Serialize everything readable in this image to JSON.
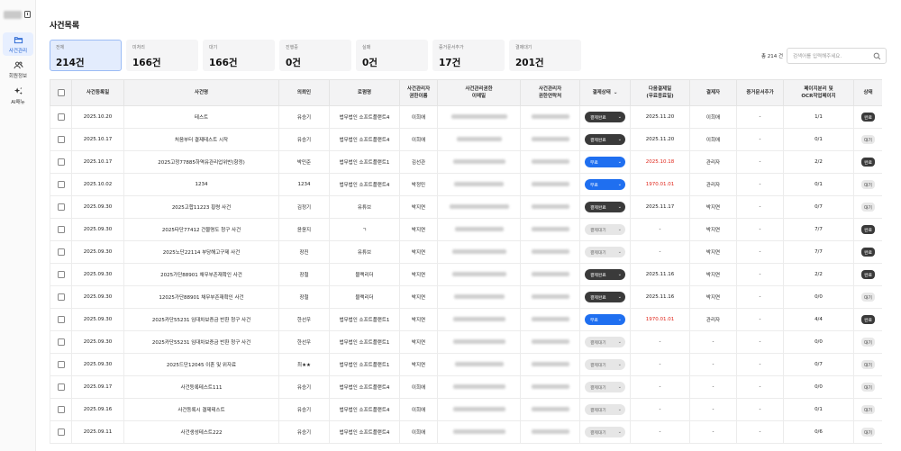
{
  "sidebar": {
    "items": [
      {
        "label": "사건관리",
        "icon": "folder-icon",
        "active": true
      },
      {
        "label": "회원정보",
        "icon": "users-icon",
        "active": false
      },
      {
        "label": "AI매뉴",
        "icon": "sparkle-icon",
        "active": false
      }
    ]
  },
  "page": {
    "title": "사건목록"
  },
  "summary": [
    {
      "label": "전체",
      "value": "214건",
      "active": true
    },
    {
      "label": "미처리",
      "value": "166건"
    },
    {
      "label": "대기",
      "value": "166건"
    },
    {
      "label": "진행중",
      "value": "0건"
    },
    {
      "label": "실패",
      "value": "0건"
    },
    {
      "label": "증거문서추가",
      "value": "17건"
    },
    {
      "label": "결제대기",
      "value": "201건"
    }
  ],
  "toolbar": {
    "total": "총 214 건",
    "search_placeholder": "검색어를 입력해주세요."
  },
  "table": {
    "headers": {
      "reg_date": "사건등록일",
      "case_name": "사건명",
      "client": "의뢰인",
      "law_firm": "로펌명",
      "manager_name_1": "사건관리자",
      "manager_name_2": "권한이름",
      "manager_email_1": "사건관리권한",
      "manager_email_2": "이메일",
      "manager_contact_1": "사건관리자",
      "manager_contact_2": "권한연락처",
      "pay_status": "결제상태",
      "next_pay_1": "다음결제일",
      "next_pay_2": "(무료종료일)",
      "payer": "결제자",
      "evidence": "증거문서추가",
      "pages_1": "페이지분리 및",
      "pages_2": "OCR작업페이지",
      "status": "상태"
    },
    "rows": [
      {
        "date": "2025.10.20",
        "name": "테스트",
        "client": "유승기",
        "firm": "법무법인 소프트플랜트4",
        "manager": "이희애",
        "pay": "결제완료",
        "pay_style": "dark",
        "next": "2025.11.20",
        "next_red": false,
        "payer": "이희애",
        "evidence": "-",
        "pages": "1/1",
        "status": "완료"
      },
      {
        "date": "2025.10.17",
        "name": "처음부터 결제테스트 시작",
        "client": "유승기",
        "firm": "법무법인 소프트플랜트4",
        "manager": "이희애",
        "pay": "결제완료",
        "pay_style": "dark",
        "next": "2025.11.20",
        "next_red": false,
        "payer": "이희애",
        "evidence": "-",
        "pages": "0/1",
        "status": "대기"
      },
      {
        "date": "2025.10.17",
        "name": "2025고정77885하역유관리업위반(항정)",
        "client": "박민준",
        "firm": "법무법인 소프트플랜트1",
        "manager": "김선관",
        "pay": "무료",
        "pay_style": "blue",
        "next": "2025.10.18",
        "next_red": true,
        "payer": "관리자",
        "evidence": "-",
        "pages": "2/2",
        "status": "완료"
      },
      {
        "date": "2025.10.02",
        "name": "1234",
        "client": "1234",
        "firm": "법무법인 소프트플랜트4",
        "manager": "박정민",
        "pay": "무료",
        "pay_style": "blue",
        "next": "1970.01.01",
        "next_red": true,
        "payer": "관리자",
        "evidence": "-",
        "pages": "0/1",
        "status": "대기"
      },
      {
        "date": "2025.09.30",
        "name": "2025고합11223 횡령 사건",
        "client": "김정기",
        "firm": "유튜브",
        "manager": "박지연",
        "pay": "결제완료",
        "pay_style": "dark",
        "next": "2025.11.17",
        "next_red": false,
        "payer": "박지연",
        "evidence": "-",
        "pages": "0/7",
        "status": "대기"
      },
      {
        "date": "2025.09.30",
        "name": "2025타단77412 건물명도 청구 사건",
        "client": "윤윤지",
        "firm": "ㄱ",
        "manager": "박지연",
        "pay": "결제대기",
        "pay_style": "gray",
        "next": "-",
        "next_red": false,
        "payer": "박지연",
        "evidence": "-",
        "pages": "7/7",
        "status": "완료"
      },
      {
        "date": "2025.09.30",
        "name": "2025노단22114 부당해고구제 사건",
        "client": "장진",
        "firm": "유튜브",
        "manager": "박지연",
        "pay": "결제대기",
        "pay_style": "gray",
        "next": "-",
        "next_red": false,
        "payer": "박지연",
        "evidence": "-",
        "pages": "7/7",
        "status": "완료"
      },
      {
        "date": "2025.09.30",
        "name": "2025가단88901 채무부존재확인 사건",
        "client": "장철",
        "firm": "블랙리더",
        "manager": "박지연",
        "pay": "결제완료",
        "pay_style": "dark",
        "next": "2025.11.16",
        "next_red": false,
        "payer": "박지연",
        "evidence": "-",
        "pages": "2/2",
        "status": "완료"
      },
      {
        "date": "2025.09.30",
        "name": "12025가단88901 채무부존재확인 사건",
        "client": "장철",
        "firm": "블랙리더",
        "manager": "박지연",
        "pay": "결제완료",
        "pay_style": "dark",
        "next": "2025.11.16",
        "next_red": false,
        "payer": "박지연",
        "evidence": "-",
        "pages": "0/0",
        "status": "대기"
      },
      {
        "date": "2025.09.30",
        "name": "2025카단55231 임대차보증금 반환 청구 사건",
        "client": "한선우",
        "firm": "법무법인 소프트플랜트1",
        "manager": "박지연",
        "pay": "무료",
        "pay_style": "blue",
        "next": "1970.01.01",
        "next_red": true,
        "payer": "관리자",
        "evidence": "-",
        "pages": "4/4",
        "status": "완료"
      },
      {
        "date": "2025.09.30",
        "name": "2025카단55231 임대차보증금 반환 청구 사건",
        "client": "한선우",
        "firm": "법무법인 소프트플랜트1",
        "manager": "박지연",
        "pay": "결제대기",
        "pay_style": "gray",
        "next": "-",
        "next_red": false,
        "payer": "-",
        "evidence": "-",
        "pages": "0/0",
        "status": "대기"
      },
      {
        "date": "2025.09.30",
        "name": "2025드단12045 이혼 및 위자료",
        "client": "최★★",
        "firm": "법무법인 소프트플랜트1",
        "manager": "박지연",
        "pay": "결제대기",
        "pay_style": "gray",
        "next": "-",
        "next_red": false,
        "payer": "-",
        "evidence": "-",
        "pages": "0/7",
        "status": "대기"
      },
      {
        "date": "2025.09.17",
        "name": "사건등록테스트111",
        "client": "유승기",
        "firm": "법무법인 소프트플랜트4",
        "manager": "이희애",
        "pay": "결제대기",
        "pay_style": "gray",
        "next": "-",
        "next_red": false,
        "payer": "-",
        "evidence": "-",
        "pages": "0/0",
        "status": "대기"
      },
      {
        "date": "2025.09.16",
        "name": "사건등록시 결제테스트",
        "client": "유승기",
        "firm": "법무법인 소프트플랜트4",
        "manager": "이희애",
        "pay": "결제대기",
        "pay_style": "gray",
        "next": "-",
        "next_red": false,
        "payer": "-",
        "evidence": "-",
        "pages": "0/1",
        "status": "대기"
      },
      {
        "date": "2025.09.11",
        "name": "사건생성테스트222",
        "client": "유승기",
        "firm": "법무법인 소프트플랜트4",
        "manager": "이희애",
        "pay": "결제대기",
        "pay_style": "gray",
        "next": "-",
        "next_red": false,
        "payer": "-",
        "evidence": "-",
        "pages": "0/6",
        "status": "대기"
      }
    ]
  },
  "colors": {
    "accent": "#1f6ff0",
    "dark_pill": "#3a3a3a",
    "danger": "#e0261b",
    "active_card": "#e3ecfd"
  }
}
